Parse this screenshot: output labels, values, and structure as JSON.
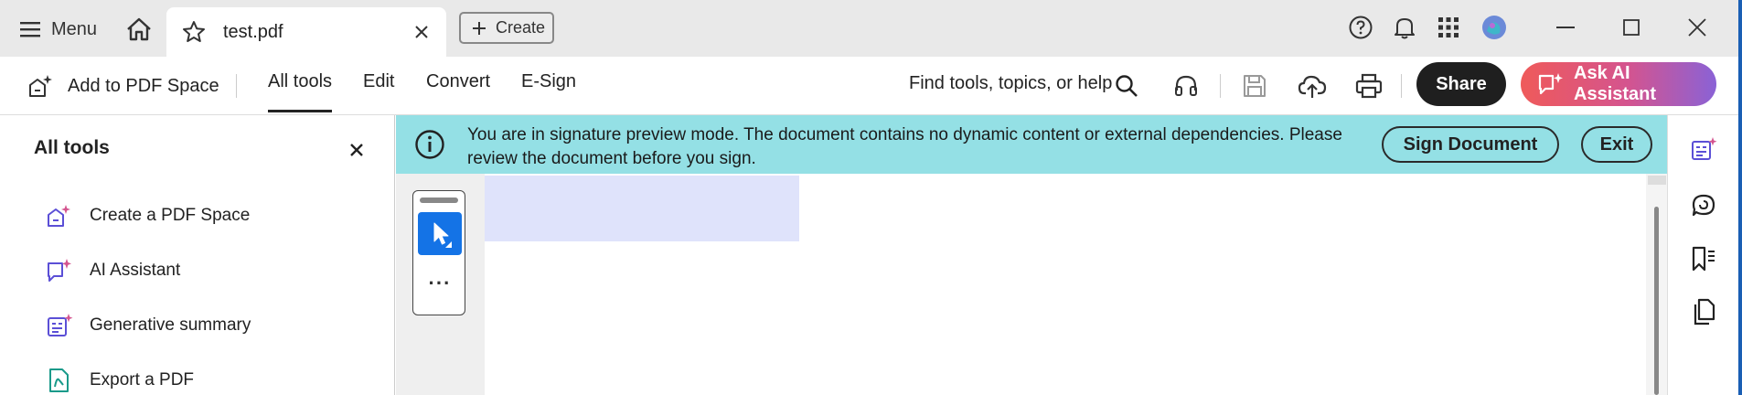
{
  "titlebar": {
    "menu_label": "Menu",
    "tab_title": "test.pdf",
    "create_label": "Create"
  },
  "toolbar": {
    "add_to_space_label": "Add to PDF Space",
    "tabs": [
      {
        "label": "All tools",
        "active": true
      },
      {
        "label": "Edit",
        "active": false
      },
      {
        "label": "Convert",
        "active": false
      },
      {
        "label": "E-Sign",
        "active": false
      }
    ],
    "find_label": "Find tools, topics, or help",
    "share_label": "Share",
    "ai_assistant_label": "Ask AI Assistant"
  },
  "left_panel": {
    "title": "All tools",
    "items": [
      {
        "label": "Create a PDF Space",
        "icon": "pdf-space-icon"
      },
      {
        "label": "AI Assistant",
        "icon": "ai-assistant-icon"
      },
      {
        "label": "Generative summary",
        "icon": "generative-summary-icon"
      },
      {
        "label": "Export a PDF",
        "icon": "export-pdf-icon"
      }
    ]
  },
  "banner": {
    "message": "You are in signature preview mode. The document contains no dynamic content or external dependencies. Please review the document before you sign.",
    "sign_label": "Sign Document",
    "exit_label": "Exit"
  },
  "colors": {
    "banner_bg": "#94e0e5",
    "accent_blue": "#1473e6",
    "tool_icon_purple": "#5b4fd6",
    "share_bg": "#1f1f1f",
    "highlight": "#dfe3fb"
  }
}
